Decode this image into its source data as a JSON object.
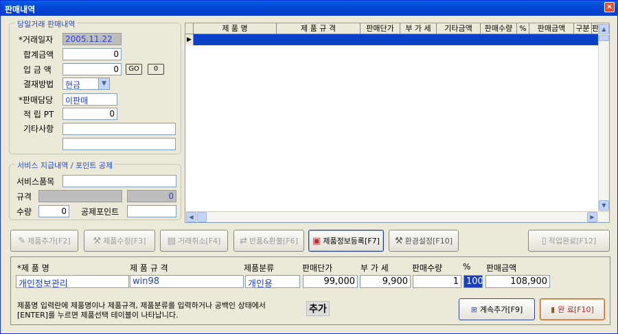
{
  "window": {
    "title": "판매내역",
    "close_glyph": "×"
  },
  "sales_group": {
    "title": "당일거래 판매내역",
    "date_label": "*거래일자",
    "date_value": "2005.11.22",
    "total_label": "합계금액",
    "total_value": "0",
    "deposit_label": "입 금 액",
    "deposit_value": "0",
    "go_label": "GO",
    "zero_label": "0",
    "payment_label": "결재방법",
    "payment_value": "현금",
    "staff_label": "*판매담당",
    "staff_value": "이판매",
    "points_label": "적 립 PT",
    "points_value": "0",
    "etc_label": "기타사항",
    "etc_value1": "",
    "etc_value2": ""
  },
  "service_group": {
    "title": "서비스 지급내역 / 포인트 공제",
    "item_label": "서비스품목",
    "item_value": "",
    "spec_label": "규격",
    "spec_value": "",
    "spec_amount": "0",
    "qty_label": "수량",
    "qty_value": "0",
    "deduct_label": "공제포인트",
    "deduct_value": ""
  },
  "grid": {
    "columns": [
      "제 품 명",
      "제 품 규 격",
      "판매단가",
      "부 가 세",
      "기타금액",
      "판매수량",
      "%",
      "판매금액",
      "구분",
      "판"
    ],
    "row_marker": "▶",
    "scroll_up": "▲",
    "scroll_down": "▼",
    "scroll_left": "◀",
    "scroll_right": "▶"
  },
  "toolbar": {
    "add": "제품추가[F2]",
    "edit": "제품수정[F3]",
    "cancel": "거래취소[F4]",
    "refund": "반품&환불[F6]",
    "register": "제품정보등록[F7]",
    "settings": "환경설정[F10]",
    "finish": "작업완료[F12]"
  },
  "entry": {
    "name_label": "*제 품 명",
    "name_value": "개인정보관리",
    "spec_label": "제 품 규 격",
    "spec_value": "win98",
    "category_label": "제품분류",
    "category_value": "개인용",
    "price_label": "판매단가",
    "price_value": "99,000",
    "vat_label": "부 가 세",
    "vat_value": "9,900",
    "qty_label": "판매수량",
    "qty_value": "1",
    "pct_label": "%",
    "pct_value": "100",
    "amount_label": "판매금액",
    "amount_value": "108,900",
    "note_line1": "제품명 입력란에 제품명이나 제품규격, 제품분류를 입력하거나 공백인 상태에서",
    "note_line2": "[ENTER]를 누르면 제품선택 테이블이 나타납니다.",
    "add_label": "추가",
    "continue_button": "계속추가[F9]",
    "done_button": "완 료[F10]"
  }
}
